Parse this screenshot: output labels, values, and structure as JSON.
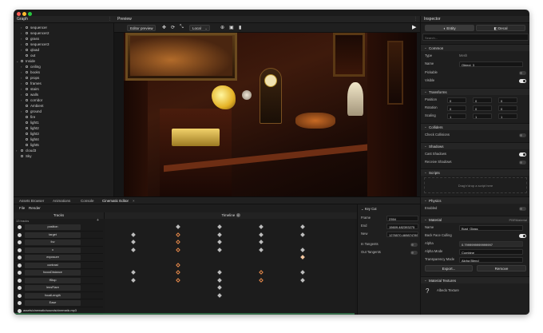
{
  "colors": {
    "accent": "#e6894a",
    "window": "#1b1b1b",
    "panel": "#1e1e1e"
  },
  "graph": {
    "title": "Graph",
    "items": [
      {
        "label": "sequencer",
        "depth": 1,
        "arrow": "›"
      },
      {
        "label": "sequencer2",
        "depth": 1,
        "arrow": "›"
      },
      {
        "label": "grass",
        "depth": 1,
        "arrow": "›"
      },
      {
        "label": "sequencer3",
        "depth": 1,
        "arrow": "›"
      },
      {
        "label": "qload",
        "depth": 1,
        "arrow": "›"
      },
      {
        "label": "out",
        "depth": 1,
        "arrow": ""
      },
      {
        "label": "Inside",
        "depth": 0,
        "arrow": "⌄"
      },
      {
        "label": "ceiling",
        "depth": 1,
        "arrow": "›"
      },
      {
        "label": "books",
        "depth": 1,
        "arrow": "›"
      },
      {
        "label": "props",
        "depth": 1,
        "arrow": "›"
      },
      {
        "label": "frames",
        "depth": 1,
        "arrow": "›"
      },
      {
        "label": "stairs",
        "depth": 1,
        "arrow": "›"
      },
      {
        "label": "walls",
        "depth": 1,
        "arrow": "›"
      },
      {
        "label": "corridor",
        "depth": 1,
        "arrow": "›"
      },
      {
        "label": "Ambient",
        "depth": 1,
        "arrow": ""
      },
      {
        "label": "ground",
        "depth": 1,
        "arrow": "›"
      },
      {
        "label": "fire",
        "depth": 1,
        "arrow": ""
      },
      {
        "label": "light1",
        "depth": 1,
        "arrow": ""
      },
      {
        "label": "light2",
        "depth": 1,
        "arrow": ""
      },
      {
        "label": "light3",
        "depth": 1,
        "arrow": ""
      },
      {
        "label": "light4",
        "depth": 1,
        "arrow": ""
      },
      {
        "label": "light5",
        "depth": 1,
        "arrow": ""
      },
      {
        "label": "cloud3",
        "depth": 0,
        "arrow": "›"
      },
      {
        "label": "Sky",
        "depth": 0,
        "arrow": ""
      }
    ]
  },
  "preview": {
    "title": "Preview",
    "mode": "Editor preview",
    "space": "Local"
  },
  "bottom": {
    "tabs": [
      "Assets Browser",
      "Animations",
      "Console",
      "Cinematic Editor"
    ],
    "menu": [
      "File",
      "Render"
    ],
    "tracks_header": "Tracks",
    "timeline_header": "Timeline",
    "track_count": "13 tracks",
    "tracks": [
      "position",
      "target",
      "fov",
      "x",
      "exposure",
      "contrast",
      "focusDistance",
      "fStop",
      "lensFlare",
      "focalLength",
      "Ease",
      "assets/cinematic/sounds/cinematic.mp3"
    ],
    "key": {
      "title": "Key Cut",
      "frame_label": "Frame",
      "frame": "2354",
      "end_label": "End",
      "end": "15609.482393275",
      "new_label": "New",
      "new": "1276570.469874789985",
      "in_label": "In Tangents",
      "out_label": "Out Tangents"
    }
  },
  "inspector": {
    "title": "Inspector",
    "tabs": [
      "Entity",
      "Decal"
    ],
    "search_placeholder": "Search...",
    "common": {
      "title": "Common",
      "type_label": "Type",
      "type": "Mesh",
      "name_label": "Name",
      "name": "Object_3",
      "pickable_label": "Pickable",
      "visible_label": "Visible"
    },
    "transforms": {
      "title": "Transforms",
      "position_label": "Position",
      "position": [
        "0",
        "0",
        "0"
      ],
      "rotation_label": "Rotation",
      "rotation": [
        "0",
        "0",
        "0"
      ],
      "scaling_label": "Scaling",
      "scaling": [
        "1",
        "1",
        "1"
      ]
    },
    "colliders": {
      "title": "Colliders",
      "check_label": "Check Collisions"
    },
    "shadows": {
      "title": "Shadows",
      "cast_label": "Cast Shadows",
      "receive_label": "Receive Shadows"
    },
    "scripts": {
      "title": "Scripts",
      "drop_hint": "Drag'n'drop a script here"
    },
    "physics": {
      "title": "Physics",
      "enabled_label": "Enabled"
    },
    "material": {
      "title": "Material",
      "type": "PBRMaterial",
      "name_label": "Name",
      "name": "Bust_Glass",
      "cull_label": "Back Face Culling",
      "alpha_label": "Alpha",
      "alpha": "0.7999999999999997",
      "alpha_mode_label": "Alpha Mode",
      "alpha_mode": "Combine",
      "transparency_label": "Transparency Mode",
      "transparency": "Alpha Blend",
      "export_label": "Export...",
      "remove_label": "Remove"
    },
    "textures": {
      "title": "Material Textures",
      "albedo_label": "Albedo Texture"
    }
  }
}
